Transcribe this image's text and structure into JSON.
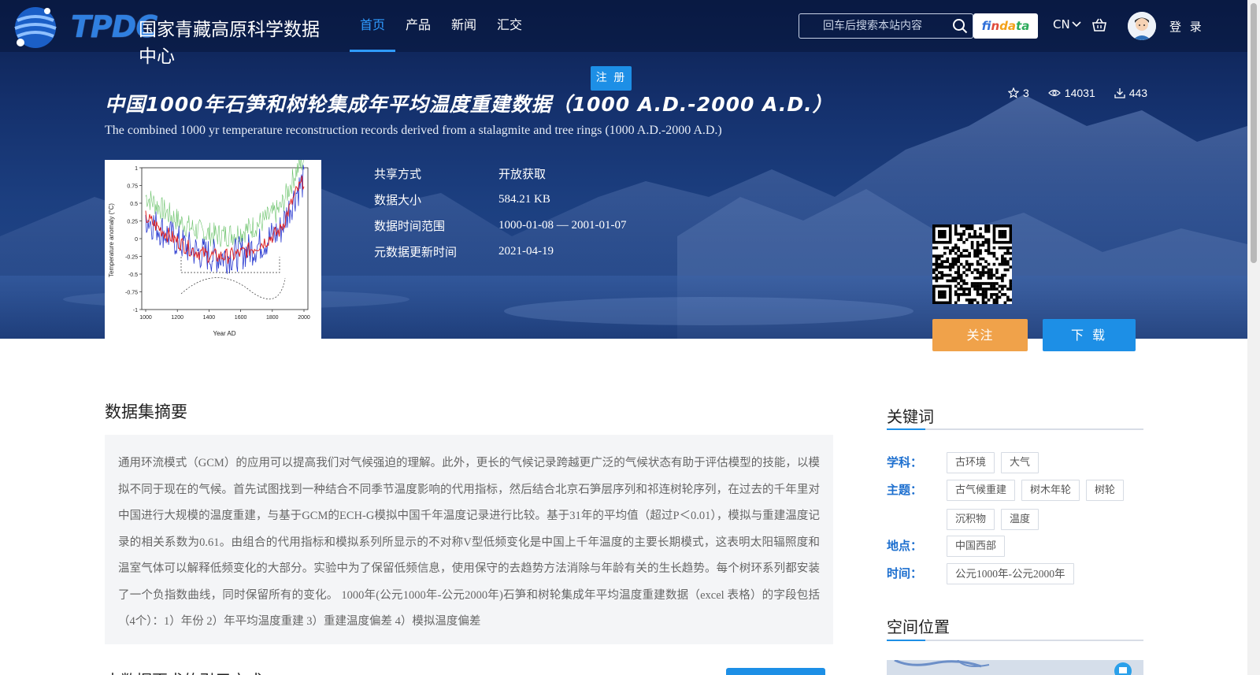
{
  "header": {
    "logo_mark": "TPDC",
    "logo_text": "国家青藏高原科学数据中心",
    "nav": [
      "首页",
      "产品",
      "新闻",
      "汇交"
    ],
    "active_nav": "首页",
    "search_placeholder": "回车后搜索本站内容",
    "findata": [
      "f",
      "in",
      "da",
      "ta"
    ],
    "lang": "CN",
    "login": "登 录"
  },
  "dataset": {
    "register_label": "注 册",
    "title_cn": "中国1000年石笋和树轮集成年平均温度重建数据（1000 A.D.-2000 A.D.）",
    "title_en": "The combined 1000 yr temperature reconstruction records derived from a stalagmite and tree rings (1000 A.D.-2000 A.D.)",
    "stats": {
      "stars": "3",
      "views": "14031",
      "downloads": "443"
    },
    "meta": [
      {
        "label": "共享方式",
        "value": "开放获取"
      },
      {
        "label": "数据大小",
        "value": "584.21 KB"
      },
      {
        "label": "数据时间范围",
        "value": "1000-01-08 — 2001-01-07"
      },
      {
        "label": "元数据更新时间",
        "value": "2021-04-19"
      }
    ],
    "follow_label": "关注",
    "download_label": "下 载",
    "thumbnail": {
      "ylabel": "Temperature anomaly (°C)",
      "xlabel": "Year AD",
      "yticks": [
        "1",
        "0.75",
        "0.5",
        "0.25",
        "0",
        "-0.25",
        "-0.5",
        "-0.75",
        "-1"
      ],
      "xticks": [
        "1000",
        "1200",
        "1400",
        "1600",
        "1800",
        "2000"
      ]
    }
  },
  "abstract": {
    "title": "数据集摘要",
    "text": "通用环流模式（GCM）的应用可以提高我们对气候强迫的理解。此外，更长的气候记录跨越更广泛的气候状态有助于评估模型的技能，以模拟不同于现在的气候。首先试图找到一种结合不同季节温度影响的代用指标，然后结合北京石笋层序列和祁连树轮序列，在过去的千年里对中国进行大规模的温度重建，与基于GCM的ECH-G模拟中国千年温度记录进行比较。基于31年的平均值（超过P＜0.01），模拟与重建温度记录的相关系数为0.61。由组合的代用指标和模拟系列所显示的不对称V型低频变化是中国上千年温度的主要长期模式，这表明太阳辐照度和温室气体可以解释低频变化的大部分。实验中为了保留低频信息，使用保守的去趋势方法消除与年龄有关的生长趋势。每个树环系列都安装了一个负指数曲线，同时保留所有的变化。 1000年(公元1000年-公元2000年)石笋和树轮集成年平均温度重建数据（excel 表格）的字段包括（4个）：1）年份 2）年平均温度重建 3）重建温度偏差 4）模拟温度偏差",
    "cite_title": "本数据更求的引用方式"
  },
  "keywords": {
    "title": "关键词",
    "groups": [
      {
        "label": "学科：",
        "tags": [
          "古环境",
          "大气"
        ]
      },
      {
        "label": "主题：",
        "tags": [
          "古气候重建",
          "树木年轮",
          "树轮",
          "沉积物",
          "温度"
        ]
      },
      {
        "label": "地点：",
        "tags": [
          "中国西部"
        ]
      },
      {
        "label": "时间：",
        "tags": [
          "公元1000年-公元2000年"
        ]
      }
    ]
  },
  "spatial": {
    "title": "空间位置"
  },
  "colors": {
    "accent": "#1d8fe6",
    "follow": "#f0a24a",
    "label_blue": "#1d6fcf"
  }
}
